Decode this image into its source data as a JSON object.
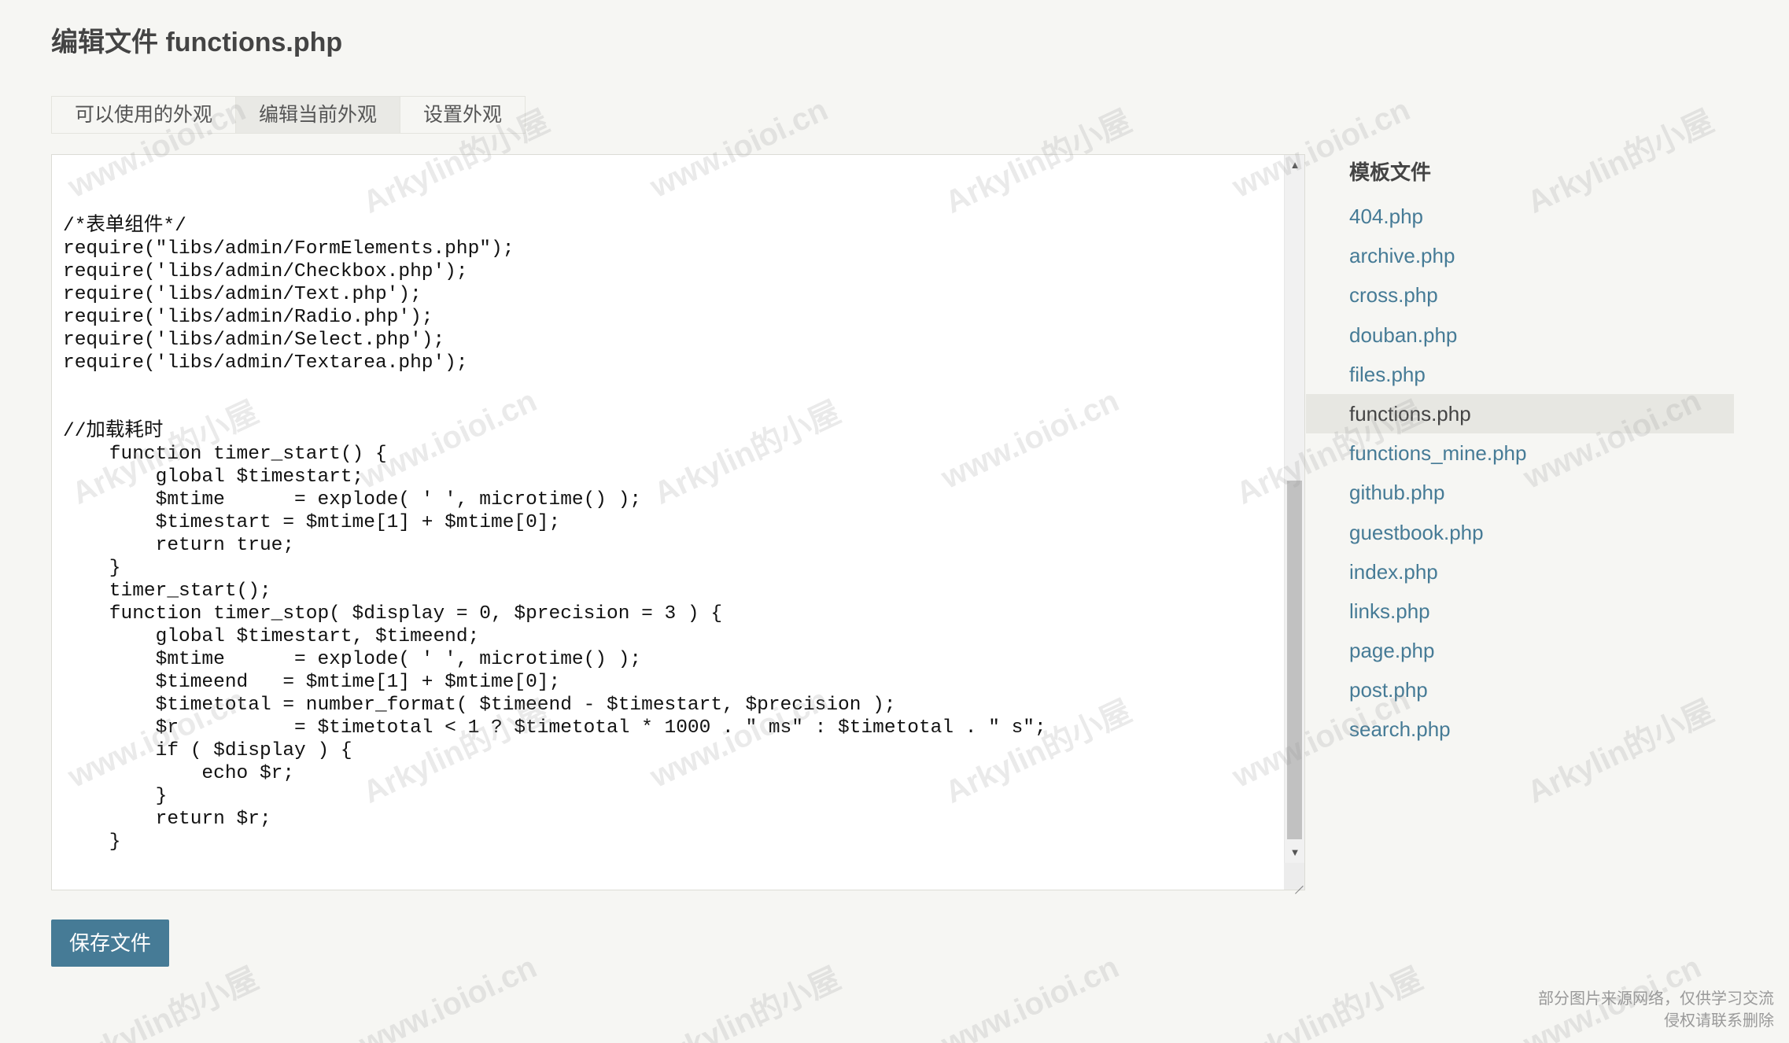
{
  "page": {
    "title": "编辑文件 functions.php"
  },
  "tabs": [
    {
      "label": "可以使用的外观",
      "active": false
    },
    {
      "label": "编辑当前外观",
      "active": true
    },
    {
      "label": "设置外观",
      "active": false
    }
  ],
  "editor": {
    "content": "/*表单组件*/\nrequire(\"libs/admin/FormElements.php\");\nrequire('libs/admin/Checkbox.php');\nrequire('libs/admin/Text.php');\nrequire('libs/admin/Radio.php');\nrequire('libs/admin/Select.php');\nrequire('libs/admin/Textarea.php');\n\n\n//加载耗时\n    function timer_start() {\n        global $timestart;\n        $mtime      = explode( ' ', microtime() );\n        $timestart = $mtime[1] + $mtime[0];\n        return true;\n    }\n    timer_start();\n    function timer_stop( $display = 0, $precision = 3 ) {\n        global $timestart, $timeend;\n        $mtime      = explode( ' ', microtime() );\n        $timeend   = $mtime[1] + $mtime[0];\n        $timetotal = number_format( $timeend - $timestart, $precision );\n        $r          = $timetotal < 1 ? $timetotal * 1000 . \" ms\" : $timetotal . \" s\";\n        if ( $display ) {\n            echo $r;\n        }\n        return $r;\n    }"
  },
  "save_button": {
    "label": "保存文件"
  },
  "sidebar": {
    "title": "模板文件",
    "files": [
      "404.php",
      "archive.php",
      "cross.php",
      "douban.php",
      "files.php",
      "functions.php",
      "functions_mine.php",
      "github.php",
      "guestbook.php",
      "index.php",
      "links.php",
      "page.php",
      "post.php",
      "search.php"
    ],
    "current": "functions.php"
  },
  "watermark": {
    "text_a": "www.ioioi.cn",
    "text_b": "Arkylin的小屋"
  },
  "copyright": {
    "line1": "部分图片来源网络，仅供学习交流",
    "line2": "侵权请联系删除"
  },
  "colors": {
    "accent": "#467b96",
    "background": "#f6f6f3",
    "selected_row": "#e7e7e2"
  }
}
